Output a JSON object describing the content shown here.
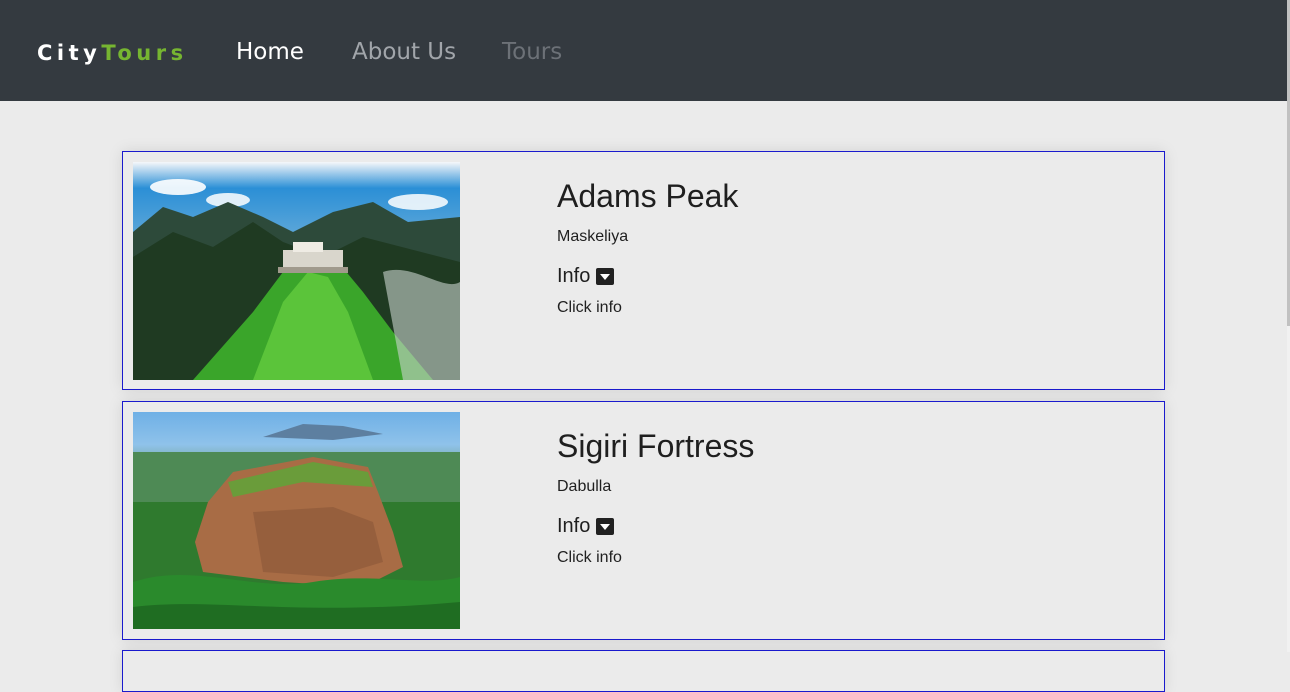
{
  "nav": {
    "brand_part1": "City",
    "brand_part2": "Tours",
    "links": [
      {
        "label": "Home",
        "state": "active"
      },
      {
        "label": "About Us",
        "state": "normal"
      },
      {
        "label": "Tours",
        "state": "muted"
      }
    ]
  },
  "colors": {
    "navbar_bg": "#343a40",
    "brand_accent": "#76b531",
    "page_bg": "#ebebeb",
    "card_border": "#1a1acd"
  },
  "tours": [
    {
      "title": "Adams Peak",
      "location": "Maskeliya",
      "info_label": "Info",
      "info_text": "Click info",
      "image": "mountain-peak-photo"
    },
    {
      "title": "Sigiri Fortress",
      "location": "Dabulla",
      "info_label": "Info",
      "info_text": "Click info",
      "image": "rock-fortress-photo"
    }
  ]
}
